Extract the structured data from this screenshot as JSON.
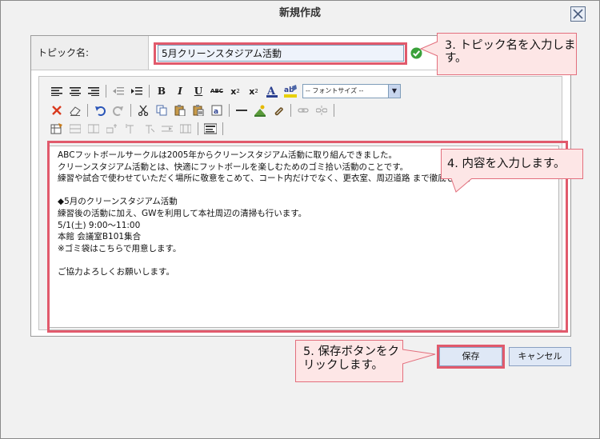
{
  "dialog": {
    "title": "新規作成"
  },
  "form": {
    "topic_label": "トピック名:",
    "topic_value": "5月クリーンスタジアム活動"
  },
  "toolbar": {
    "fontsize_placeholder": "-- フォントサイズ --"
  },
  "content": {
    "lines": [
      "ABCフットボールサークルは2005年からクリーンスタジアム活動に取り組んできました。",
      "クリーンスタジアム活動とは、快適にフットボールを楽しむためのゴミ拾い活動のことです。",
      "練習や試合で使わせていただく場所に敬意をこめて、コート内だけでなく、更衣室、周辺道路 まで徹底して行",
      "",
      "◆5月のクリーンスタジアム活動",
      "練習後の活動に加え、GWを利用して本社周辺の清掃も行います。",
      "5/1(土) 9:00〜11:00",
      "本館 会議室B101集合",
      "※ゴミ袋はこちらで用意します。",
      "",
      "ご協力よろしくお願いします。"
    ]
  },
  "buttons": {
    "save": "保存",
    "cancel": "キャンセル"
  },
  "callouts": {
    "step3": "3. トピック名を入力します。",
    "step4": "4. 内容を入力します。",
    "step5": "5. 保存ボタンをクリックします。"
  },
  "colors": {
    "highlight": "#e15a6c",
    "callout_bg": "#fde6e6",
    "button_bg": "#dfe8f6"
  }
}
